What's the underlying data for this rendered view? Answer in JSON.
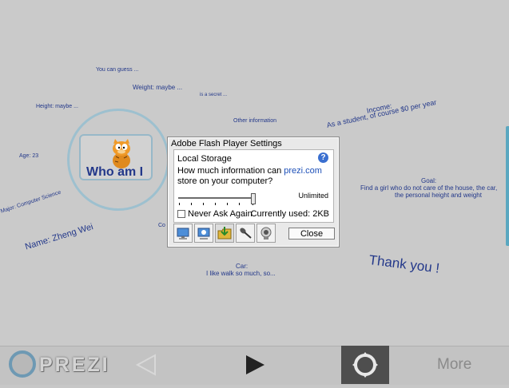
{
  "canvas": {
    "labels": {
      "guess": "You can guess ...",
      "weight": "Weight: maybe ...",
      "secret": "is a secret ...",
      "height": "Height: maybe ...",
      "other": "Other information",
      "age": "Age: 23",
      "major": "Major: Computer Science",
      "name": "Name: Zheng Wei",
      "income_title": "Income:",
      "income_text": "As a student, of course $0 per year",
      "goal_title": "Goal:",
      "goal_line1": "Find a girl who do not care of the house, the car,",
      "goal_line2": "the personal height and weight",
      "car_title": "Car:",
      "car_text": "I like walk so much, so...",
      "thanks": "Thank you !",
      "partial": "Co"
    },
    "card_title": "Who am I"
  },
  "flash_dialog": {
    "title": "Adobe Flash Player Settings",
    "section": "Local Storage",
    "question_prefix": "How much information can ",
    "domain": "prezi.com",
    "question_suffix": "store on your computer?",
    "slider_value": "Unlimited",
    "never_ask": "Never Ask Again",
    "currently_used": "Currently used: 2KB",
    "close_label": "Close",
    "help_glyph": "?"
  },
  "toolbar": {
    "logo_text": "PREZI",
    "more_label": "More"
  },
  "colors": {
    "canvas_text": "#23388a",
    "link": "#1c4fb8",
    "accent_ring": "#9dc0cf",
    "settings_bg": "#4e4e4e"
  }
}
